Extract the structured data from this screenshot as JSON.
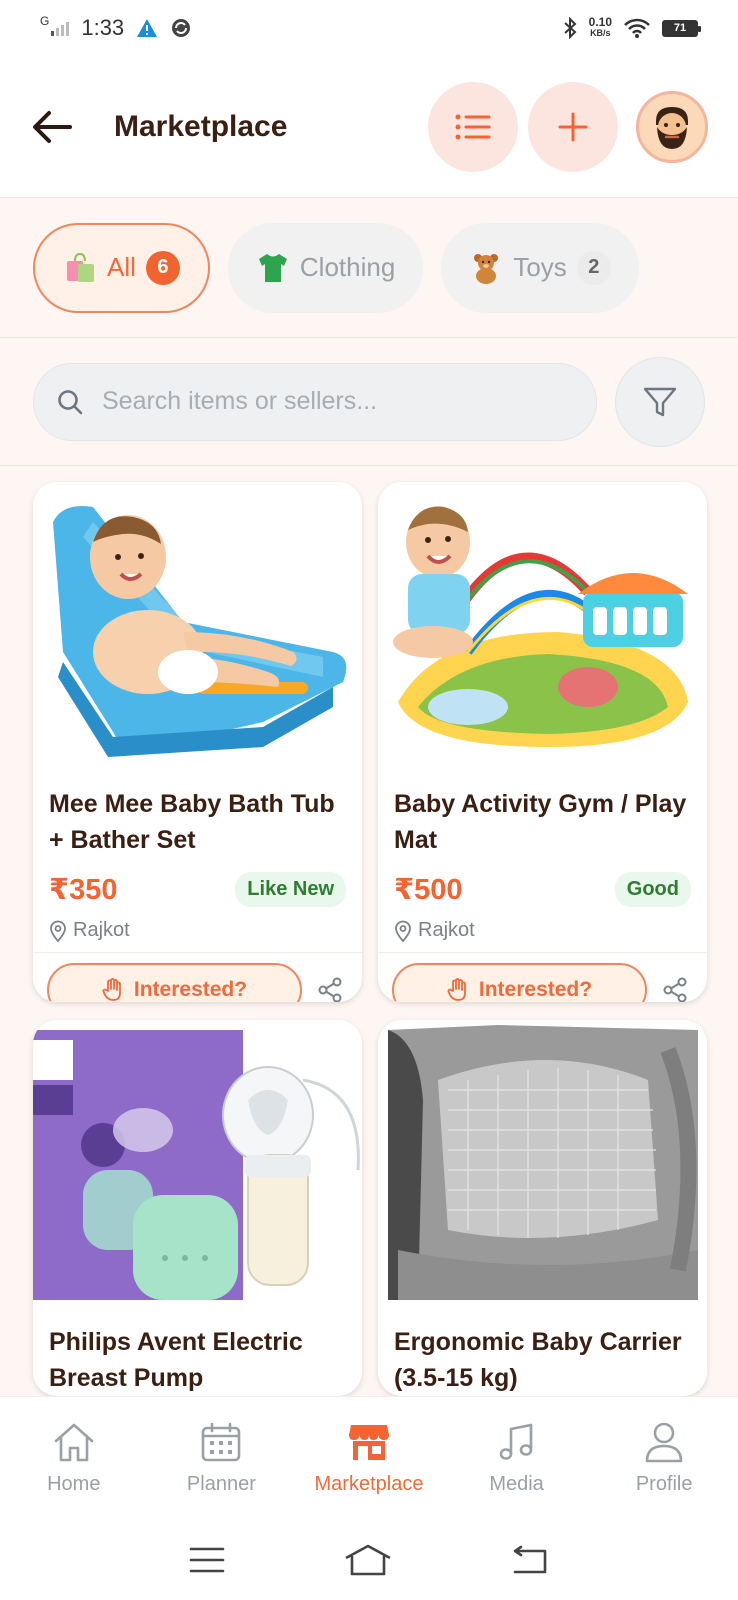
{
  "status_bar": {
    "network_letter": "G",
    "time": "1:33",
    "speed_value": "0.10",
    "speed_unit": "KB/s",
    "battery": "71"
  },
  "header": {
    "title": "Marketplace"
  },
  "categories": [
    {
      "label": "All",
      "count": "6",
      "icon": "shopping-bag-icon",
      "active": true
    },
    {
      "label": "Clothing",
      "count": "",
      "icon": "tshirt-icon",
      "active": false
    },
    {
      "label": "Toys",
      "count": "2",
      "icon": "teddy-bear-icon",
      "active": false
    }
  ],
  "search": {
    "placeholder": "Search items or sellers..."
  },
  "listings": [
    {
      "name": "Mee Mee Baby Bath Tub + Bather Set",
      "price": "₹350",
      "condition": "Like New",
      "location": "Rajkot",
      "action": "Interested?"
    },
    {
      "name": "Baby Activity Gym / Play Mat",
      "price": "₹500",
      "condition": "Good",
      "location": "Rajkot",
      "action": "Interested?"
    },
    {
      "name": "Philips Avent Electric Breast Pump",
      "price": "",
      "condition": "",
      "location": "",
      "action": ""
    },
    {
      "name": "Ergonomic Baby Carrier (3.5-15 kg)",
      "price": "",
      "condition": "",
      "location": "",
      "action": ""
    }
  ],
  "bottom_nav": [
    {
      "label": "Home",
      "icon": "home-icon",
      "active": false
    },
    {
      "label": "Planner",
      "icon": "calendar-icon",
      "active": false
    },
    {
      "label": "Marketplace",
      "icon": "store-icon",
      "active": true
    },
    {
      "label": "Media",
      "icon": "music-icon",
      "active": false
    },
    {
      "label": "Profile",
      "icon": "user-icon",
      "active": false
    }
  ],
  "colors": {
    "accent": "#f26433",
    "accent_soft": "#fde5df",
    "background": "#fdf6f2",
    "condition_green": "#2e7d32"
  }
}
